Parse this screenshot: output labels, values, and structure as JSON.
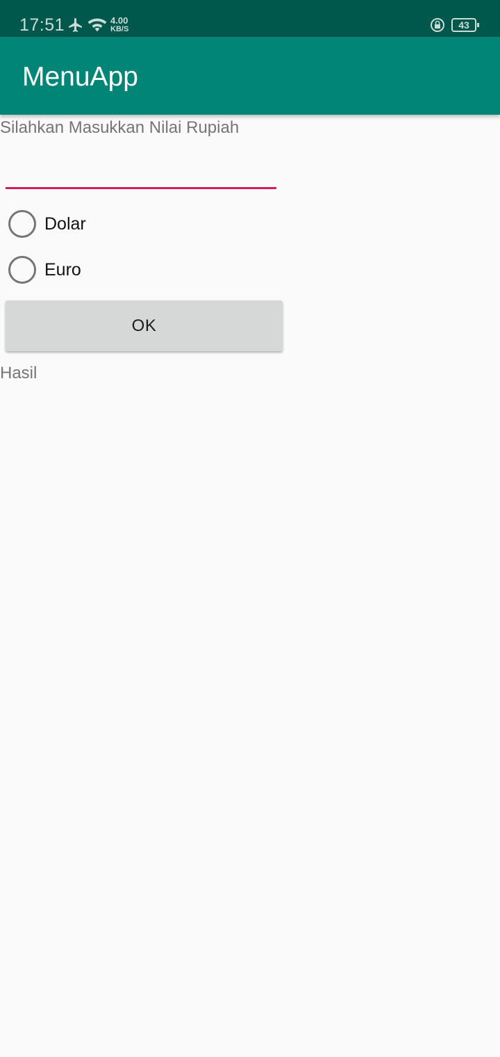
{
  "status_bar": {
    "time": "17:51",
    "net_speed_value": "4.00",
    "net_speed_unit": "KB/S",
    "battery_level": "43",
    "icons": [
      "airplane-icon",
      "wifi-icon",
      "rotation-lock-icon",
      "battery-icon"
    ]
  },
  "app_bar": {
    "title": "MenuApp"
  },
  "form": {
    "prompt_label": "Silahkan Masukkan Nilai Rupiah",
    "amount_value": "",
    "radio_options": [
      {
        "label": "Dolar",
        "selected": false
      },
      {
        "label": "Euro",
        "selected": false
      }
    ],
    "ok_label": "OK",
    "result_label": "Hasil"
  },
  "colors": {
    "status_bar": "#00574b",
    "app_bar": "#008577",
    "input_underline": "#d81b60",
    "button": "#d6d7d7",
    "background": "#fafafa"
  }
}
